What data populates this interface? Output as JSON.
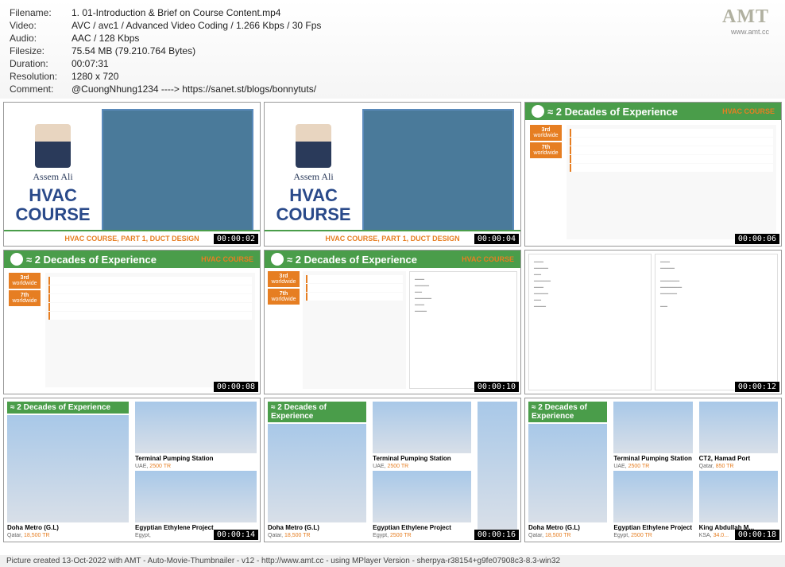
{
  "header": {
    "rows": [
      {
        "label": "Filename:",
        "value": "1. 01-Introduction & Brief on Course Content.mp4"
      },
      {
        "label": "Video:",
        "value": "AVC / avc1 / Advanced Video Coding / 1.266 Kbps / 30 Fps"
      },
      {
        "label": "Audio:",
        "value": "AAC / 128 Kbps"
      },
      {
        "label": "Filesize:",
        "value": "75.54 MB (79.210.764 Bytes)"
      },
      {
        "label": "Duration:",
        "value": "00:07:31"
      },
      {
        "label": "Resolution:",
        "value": "1280 x 720"
      },
      {
        "label": "Comment:",
        "value": "@CuongNhung1234 ----> https://sanet.st/blogs/bonnytuts/"
      }
    ],
    "logo": "AMT",
    "logo_url": "www.amt.cc"
  },
  "slides": {
    "hvac_title": "HVAC\nCOURSE",
    "hvac_subtitle": "HVAC COURSE, PART 1, DUCT DESIGN",
    "author": "Assem Ali",
    "experience_title": "≈ 2 Decades of Experience",
    "hvac_badge": "HVAC COURSE",
    "rank1": "3rd",
    "rank1_sub": "worldwide",
    "rank2": "7th",
    "rank2_sub": "worldwide"
  },
  "projects": {
    "col1_head": "≈ 2 Decades of Experience",
    "p1_name": "Doha Metro (G.L)",
    "p1_loc": "Qatar,",
    "p1_tr": "18,500 TR",
    "p2_name": "Terminal Pumping Station",
    "p2_loc": "UAE,",
    "p2_tr": "2500 TR",
    "p3_name": "Egyptian Ethylene Project",
    "p3_loc": "Egypt,",
    "p3_tr": "2500 TR",
    "p4_name": "CT2, Hamad Port",
    "p4_loc": "Qatar,",
    "p4_tr": "850 TR",
    "p5_name": "King Abdullah M...",
    "p5_loc": "KSA,",
    "p5_tr": "34.0...",
    "p6_name": "King A..."
  },
  "timestamps": [
    "00:00:02",
    "00:00:04",
    "00:00:06",
    "00:00:08",
    "00:00:10",
    "00:00:12",
    "00:00:14",
    "00:00:16",
    "00:00:18"
  ],
  "footer": "Picture created 13-Oct-2022 with AMT - Auto-Movie-Thumbnailer - v12 - http://www.amt.cc - using MPlayer Version - sherpya-r38154+g9fe07908c3-8.3-win32"
}
